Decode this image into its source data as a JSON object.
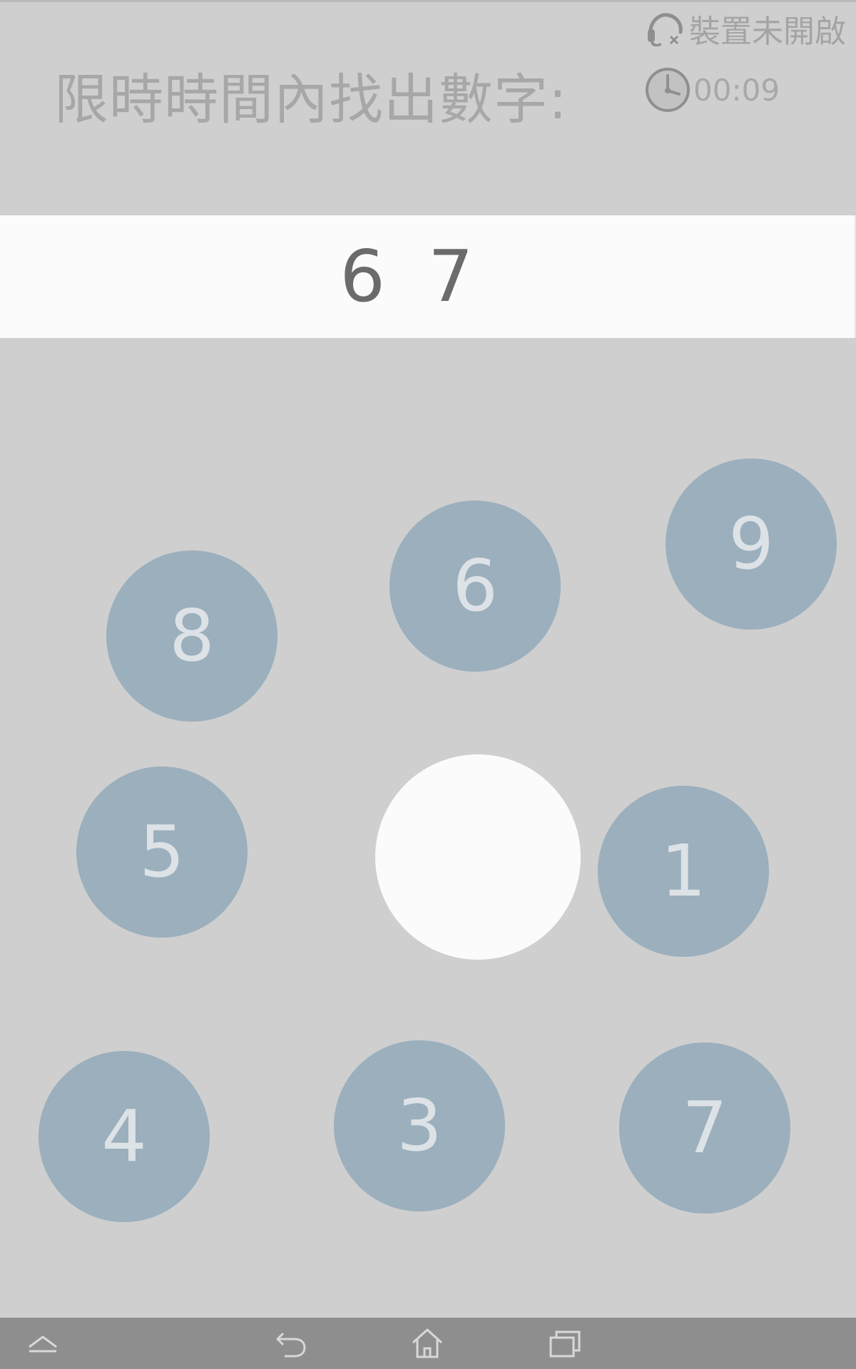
{
  "status": {
    "device_label": "裝置未開啟",
    "device_icon": "headset-disconnected-icon"
  },
  "timer": {
    "icon": "clock-icon",
    "value": "00:09"
  },
  "instruction": "限時時間內找出數字:",
  "target": {
    "digits": [
      "6",
      "7"
    ]
  },
  "bubbles": [
    "8",
    "6",
    "9",
    "5",
    "1",
    "4",
    "3",
    "7"
  ],
  "nav": {
    "icons": [
      "chevron-up-icon",
      "back-icon",
      "home-icon",
      "recent-apps-icon"
    ]
  },
  "colors": {
    "background": "#cfcfcf",
    "bubble": "#9bafbd",
    "bubble_text": "#dde2e6",
    "panel": "#fbfbfb",
    "nav_bar": "#8e8e8e"
  }
}
